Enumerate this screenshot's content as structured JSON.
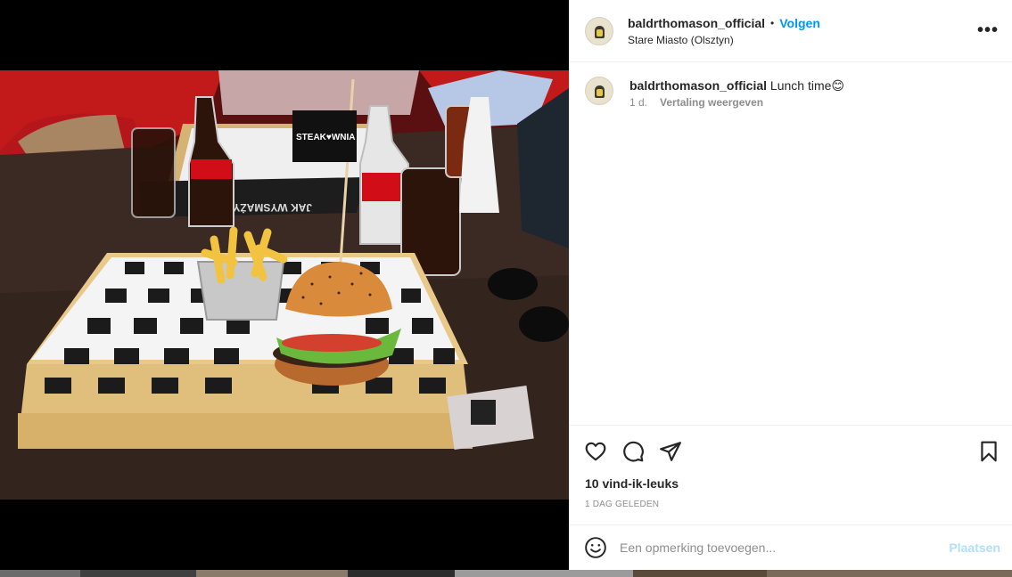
{
  "post": {
    "username": "baldrthomason_official",
    "follow_label": "Volgen",
    "separator": "•",
    "location": "Stare Miasto (Olsztyn)",
    "more_label": "•••"
  },
  "caption": {
    "username": "baldrthomason_official",
    "text": "Lunch time😊",
    "age": "1 d.",
    "translate_label": "Vertaling weergeven"
  },
  "engagement": {
    "likes": "10 vind-ik-leuks",
    "time_ago": "1 DAG GELEDEN"
  },
  "comment": {
    "placeholder": "Een opmerking toevoegen...",
    "post_label": "Plaatsen"
  },
  "photo": {
    "flag_text": "STEAK♥WNIA",
    "tray_text": "JAK WYSMAŻYĆ"
  },
  "colors": {
    "link_blue": "#0095f6",
    "post_disabled": "#b2dffc",
    "muted": "#8e8e8e",
    "divider": "#efefef"
  },
  "icons": [
    "heart-icon",
    "comment-icon",
    "share-icon",
    "bookmark-icon",
    "emoji-icon",
    "more-icon"
  ]
}
